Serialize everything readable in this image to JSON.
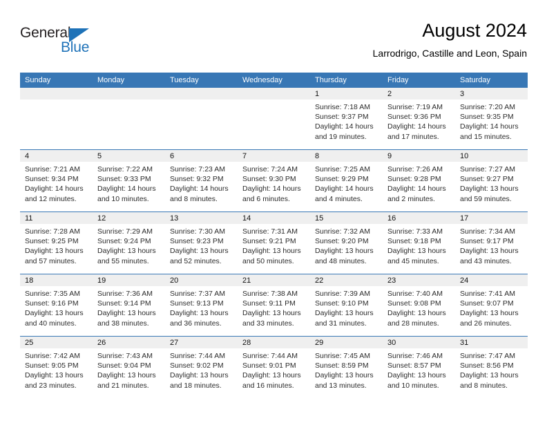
{
  "brand": {
    "name_part1": "General",
    "name_part2": "Blue",
    "triangle_color": "#1e72b8",
    "text_color": "#231f20"
  },
  "header": {
    "title": "August 2024",
    "subtitle": "Larrodrigo, Castille and Leon, Spain"
  },
  "theme": {
    "header_blue": "#3877b5",
    "daynum_band": "#efefef",
    "row_divider": "#3877b5"
  },
  "weekday_headers": [
    "Sunday",
    "Monday",
    "Tuesday",
    "Wednesday",
    "Thursday",
    "Friday",
    "Saturday"
  ],
  "weeks": [
    [
      {
        "day": "",
        "empty": true
      },
      {
        "day": "",
        "empty": true
      },
      {
        "day": "",
        "empty": true
      },
      {
        "day": "",
        "empty": true
      },
      {
        "day": "1",
        "sunrise": "Sunrise: 7:18 AM",
        "sunset": "Sunset: 9:37 PM",
        "daylight": "Daylight: 14 hours and 19 minutes."
      },
      {
        "day": "2",
        "sunrise": "Sunrise: 7:19 AM",
        "sunset": "Sunset: 9:36 PM",
        "daylight": "Daylight: 14 hours and 17 minutes."
      },
      {
        "day": "3",
        "sunrise": "Sunrise: 7:20 AM",
        "sunset": "Sunset: 9:35 PM",
        "daylight": "Daylight: 14 hours and 15 minutes."
      }
    ],
    [
      {
        "day": "4",
        "sunrise": "Sunrise: 7:21 AM",
        "sunset": "Sunset: 9:34 PM",
        "daylight": "Daylight: 14 hours and 12 minutes."
      },
      {
        "day": "5",
        "sunrise": "Sunrise: 7:22 AM",
        "sunset": "Sunset: 9:33 PM",
        "daylight": "Daylight: 14 hours and 10 minutes."
      },
      {
        "day": "6",
        "sunrise": "Sunrise: 7:23 AM",
        "sunset": "Sunset: 9:32 PM",
        "daylight": "Daylight: 14 hours and 8 minutes."
      },
      {
        "day": "7",
        "sunrise": "Sunrise: 7:24 AM",
        "sunset": "Sunset: 9:30 PM",
        "daylight": "Daylight: 14 hours and 6 minutes."
      },
      {
        "day": "8",
        "sunrise": "Sunrise: 7:25 AM",
        "sunset": "Sunset: 9:29 PM",
        "daylight": "Daylight: 14 hours and 4 minutes."
      },
      {
        "day": "9",
        "sunrise": "Sunrise: 7:26 AM",
        "sunset": "Sunset: 9:28 PM",
        "daylight": "Daylight: 14 hours and 2 minutes."
      },
      {
        "day": "10",
        "sunrise": "Sunrise: 7:27 AM",
        "sunset": "Sunset: 9:27 PM",
        "daylight": "Daylight: 13 hours and 59 minutes."
      }
    ],
    [
      {
        "day": "11",
        "sunrise": "Sunrise: 7:28 AM",
        "sunset": "Sunset: 9:25 PM",
        "daylight": "Daylight: 13 hours and 57 minutes."
      },
      {
        "day": "12",
        "sunrise": "Sunrise: 7:29 AM",
        "sunset": "Sunset: 9:24 PM",
        "daylight": "Daylight: 13 hours and 55 minutes."
      },
      {
        "day": "13",
        "sunrise": "Sunrise: 7:30 AM",
        "sunset": "Sunset: 9:23 PM",
        "daylight": "Daylight: 13 hours and 52 minutes."
      },
      {
        "day": "14",
        "sunrise": "Sunrise: 7:31 AM",
        "sunset": "Sunset: 9:21 PM",
        "daylight": "Daylight: 13 hours and 50 minutes."
      },
      {
        "day": "15",
        "sunrise": "Sunrise: 7:32 AM",
        "sunset": "Sunset: 9:20 PM",
        "daylight": "Daylight: 13 hours and 48 minutes."
      },
      {
        "day": "16",
        "sunrise": "Sunrise: 7:33 AM",
        "sunset": "Sunset: 9:18 PM",
        "daylight": "Daylight: 13 hours and 45 minutes."
      },
      {
        "day": "17",
        "sunrise": "Sunrise: 7:34 AM",
        "sunset": "Sunset: 9:17 PM",
        "daylight": "Daylight: 13 hours and 43 minutes."
      }
    ],
    [
      {
        "day": "18",
        "sunrise": "Sunrise: 7:35 AM",
        "sunset": "Sunset: 9:16 PM",
        "daylight": "Daylight: 13 hours and 40 minutes."
      },
      {
        "day": "19",
        "sunrise": "Sunrise: 7:36 AM",
        "sunset": "Sunset: 9:14 PM",
        "daylight": "Daylight: 13 hours and 38 minutes."
      },
      {
        "day": "20",
        "sunrise": "Sunrise: 7:37 AM",
        "sunset": "Sunset: 9:13 PM",
        "daylight": "Daylight: 13 hours and 36 minutes."
      },
      {
        "day": "21",
        "sunrise": "Sunrise: 7:38 AM",
        "sunset": "Sunset: 9:11 PM",
        "daylight": "Daylight: 13 hours and 33 minutes."
      },
      {
        "day": "22",
        "sunrise": "Sunrise: 7:39 AM",
        "sunset": "Sunset: 9:10 PM",
        "daylight": "Daylight: 13 hours and 31 minutes."
      },
      {
        "day": "23",
        "sunrise": "Sunrise: 7:40 AM",
        "sunset": "Sunset: 9:08 PM",
        "daylight": "Daylight: 13 hours and 28 minutes."
      },
      {
        "day": "24",
        "sunrise": "Sunrise: 7:41 AM",
        "sunset": "Sunset: 9:07 PM",
        "daylight": "Daylight: 13 hours and 26 minutes."
      }
    ],
    [
      {
        "day": "25",
        "sunrise": "Sunrise: 7:42 AM",
        "sunset": "Sunset: 9:05 PM",
        "daylight": "Daylight: 13 hours and 23 minutes."
      },
      {
        "day": "26",
        "sunrise": "Sunrise: 7:43 AM",
        "sunset": "Sunset: 9:04 PM",
        "daylight": "Daylight: 13 hours and 21 minutes."
      },
      {
        "day": "27",
        "sunrise": "Sunrise: 7:44 AM",
        "sunset": "Sunset: 9:02 PM",
        "daylight": "Daylight: 13 hours and 18 minutes."
      },
      {
        "day": "28",
        "sunrise": "Sunrise: 7:44 AM",
        "sunset": "Sunset: 9:01 PM",
        "daylight": "Daylight: 13 hours and 16 minutes."
      },
      {
        "day": "29",
        "sunrise": "Sunrise: 7:45 AM",
        "sunset": "Sunset: 8:59 PM",
        "daylight": "Daylight: 13 hours and 13 minutes."
      },
      {
        "day": "30",
        "sunrise": "Sunrise: 7:46 AM",
        "sunset": "Sunset: 8:57 PM",
        "daylight": "Daylight: 13 hours and 10 minutes."
      },
      {
        "day": "31",
        "sunrise": "Sunrise: 7:47 AM",
        "sunset": "Sunset: 8:56 PM",
        "daylight": "Daylight: 13 hours and 8 minutes."
      }
    ]
  ]
}
